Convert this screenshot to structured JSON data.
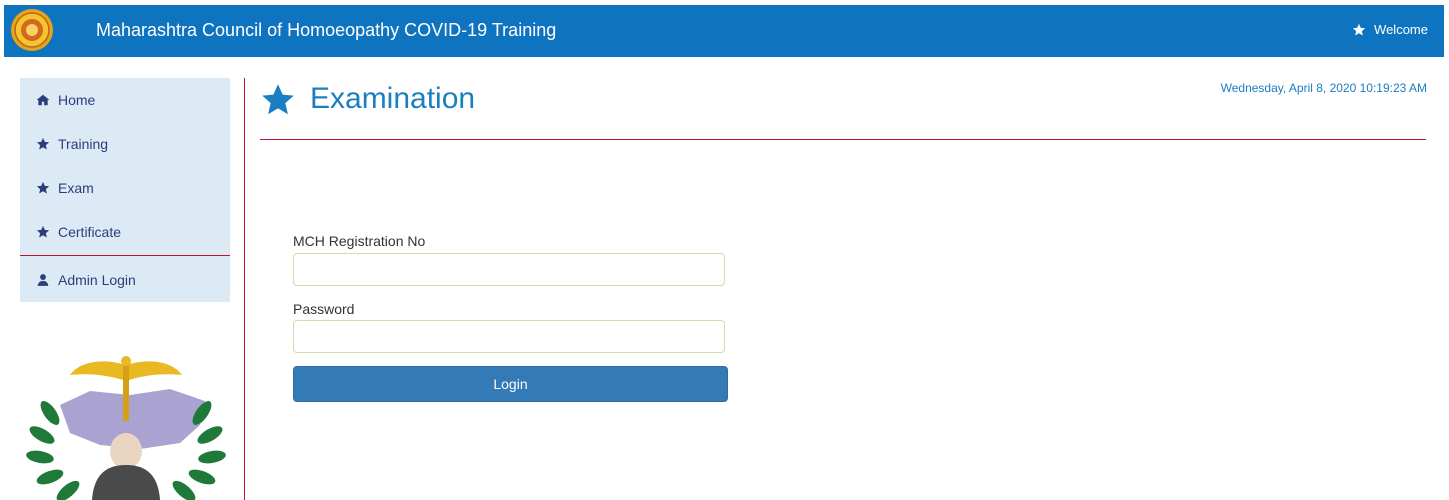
{
  "header": {
    "title": "Maharashtra Council of Homoeopathy COVID-19 Training",
    "welcome": "Welcome",
    "emblem_icon": "state-emblem-icon",
    "welcome_icon": "star-icon",
    "bar_color": "#0f74c0"
  },
  "sidebar": {
    "items": [
      {
        "label": "Home",
        "icon": "home-icon"
      },
      {
        "label": "Training",
        "icon": "star-icon"
      },
      {
        "label": "Exam",
        "icon": "star-icon"
      },
      {
        "label": "Certificate",
        "icon": "star-icon"
      },
      {
        "label": "Admin Login",
        "icon": "user-icon"
      }
    ],
    "background": "#dceaf6",
    "logo_icon": "council-logo"
  },
  "main": {
    "title": "Examination",
    "title_icon": "star-icon",
    "datetime": "Wednesday, April 8, 2020 10:19:23 AM",
    "form": {
      "registration_label": "MCH Registration No",
      "registration_value": "",
      "password_label": "Password",
      "password_value": "",
      "login_label": "Login"
    }
  },
  "colors": {
    "accent": "#1a7fc1",
    "divider": "#c8102e",
    "button": "#337ab7"
  }
}
